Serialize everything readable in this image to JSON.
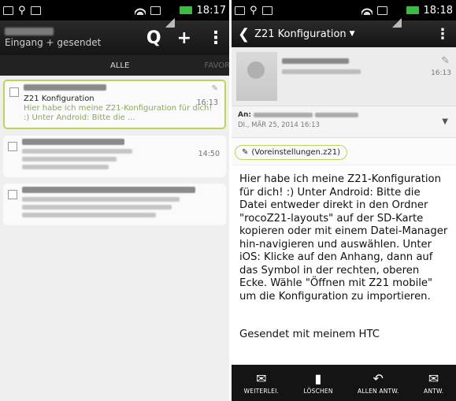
{
  "colors": {
    "accent": "#b8d65a",
    "battery": "#3fb93f"
  },
  "statusbar": {
    "time": "18:17",
    "time_right": "18:18"
  },
  "inbox": {
    "folder": "Eingang + gesendet",
    "actions": {
      "search": "Q",
      "add": "+",
      "menu": "⋮"
    },
    "tabs": {
      "all": "ALLE",
      "favorites": "FAVORI"
    },
    "items": [
      {
        "subject": "Z21 Konfiguration",
        "preview": "Hier habe ich meine Z21-Konfiguration für dich! :) Unter Android: Bitte die ...",
        "time": "16:13",
        "selected": true
      },
      {
        "subject": "",
        "preview": "",
        "time": "14:50",
        "selected": false
      },
      {
        "subject": "",
        "preview": "",
        "time": "",
        "selected": false
      }
    ]
  },
  "reader": {
    "title": "Z21 Konfiguration",
    "sender_time": "16:13",
    "to_label": "An:",
    "date": "DI., MÄR 25, 2014 16:13",
    "attachment": "(Voreinstellungen.z21)",
    "body": "Hier habe ich meine Z21-Konfiguration für dich! :) Unter Android: Bitte die Datei entweder direkt in den Ordner \"rocoZ21-layouts\" auf der SD-Karte kopieren oder mit einem Datei-Manager hin-navigieren und auswählen. Unter iOS: Klicke auf den Anhang, dann auf das Symbol in der rechten, oberen Ecke. Wähle \"Öffnen mit Z21 mobile\" um die Konfiguration zu importieren.",
    "signature": "Gesendet mit meinem HTC",
    "toolbar": [
      {
        "label": "WEITERLEI.",
        "icon": "forward-icon"
      },
      {
        "label": "LÖSCHEN",
        "icon": "trash-icon"
      },
      {
        "label": "ALLEN ANTW.",
        "icon": "reply-all-icon"
      },
      {
        "label": "ANTW.",
        "icon": "reply-icon"
      }
    ]
  }
}
